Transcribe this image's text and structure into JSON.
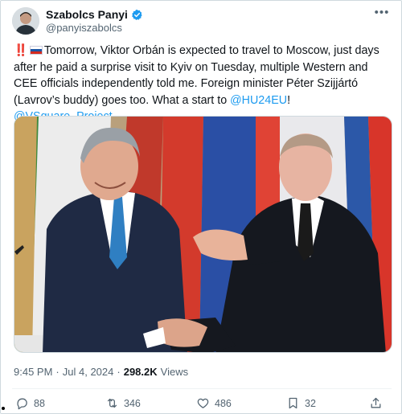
{
  "author": {
    "name": "Szabolcs Panyi",
    "handle": "@panyiszabolcs"
  },
  "tweet": {
    "bang": "‼️",
    "text_main": "Tomorrow, Viktor Orbán is expected to travel to Moscow, just days after he paid a surprise visit to Kyiv on Tuesday, multiple Western and CEE officials independently told me. Foreign minister Péter Szijjártó (Lavrov’s buddy) goes too. What a start to ",
    "mention1": "@HU24EU",
    "sep": "! ",
    "mention2": "@VSquare_Project"
  },
  "meta": {
    "time": "9:45 PM",
    "dot": "·",
    "date": "Jul 4, 2024",
    "dot2": "·",
    "views_count": "298.2K",
    "views_label": "Views"
  },
  "actions": {
    "replies": "88",
    "reposts": "346",
    "likes": "486",
    "bookmarks": "32"
  },
  "icons": {
    "verified": "verified-badge-icon",
    "more": "more-icon",
    "reply": "reply-icon",
    "repost": "repost-icon",
    "like": "heart-icon",
    "bookmark": "bookmark-icon",
    "share": "share-icon"
  },
  "colors": {
    "accent": "#1d9bf0",
    "muted": "#536471",
    "text": "#0f1419"
  }
}
